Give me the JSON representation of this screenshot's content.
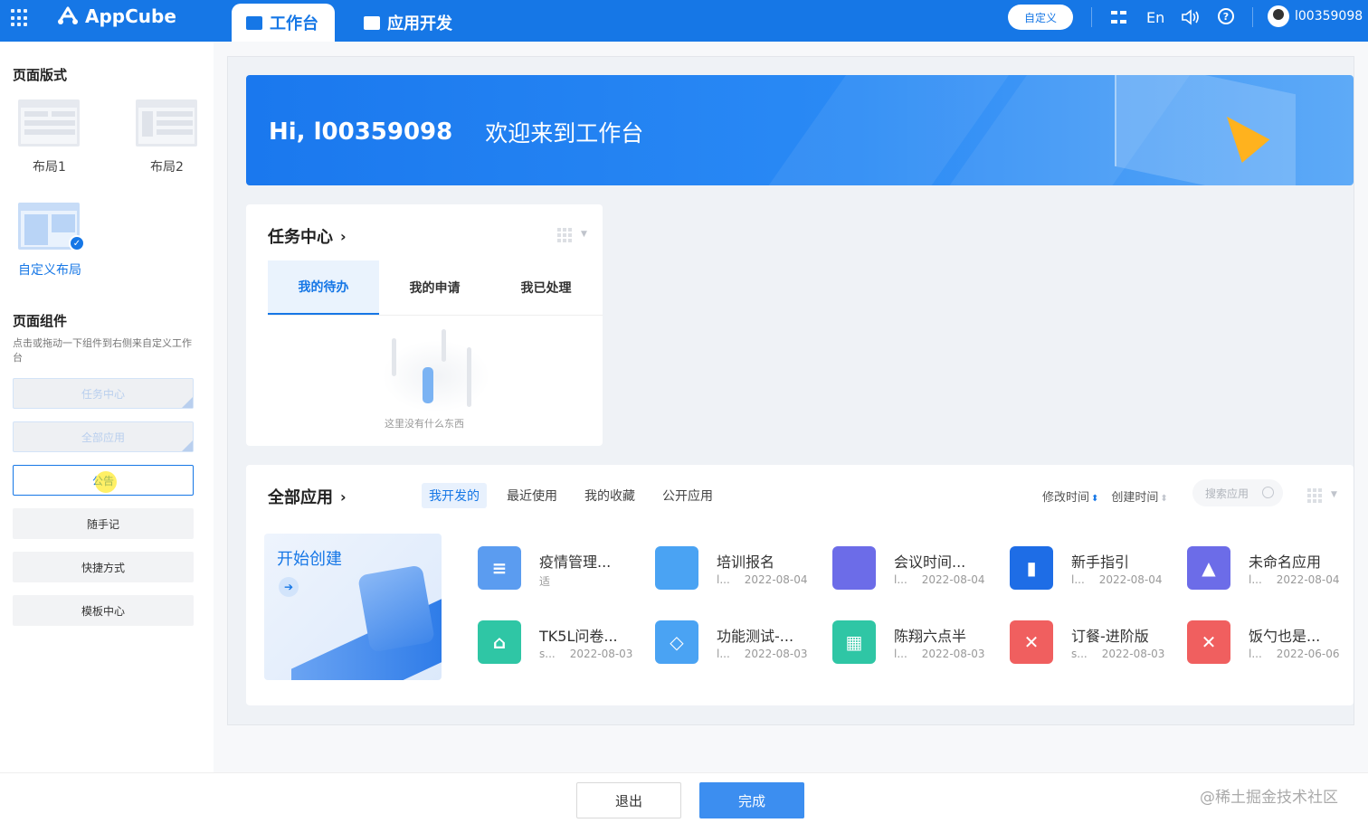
{
  "header": {
    "logo": "AppCube",
    "tabs": [
      {
        "label": "工作台"
      },
      {
        "label": "应用开发"
      }
    ],
    "custom_button": "自定义",
    "lang": "En",
    "help": "?",
    "username": "l00359098"
  },
  "sidebar": {
    "layout_title": "页面版式",
    "layouts": [
      "布局1",
      "布局2"
    ],
    "custom_layout": "自定义布局",
    "components_title": "页面组件",
    "components_hint": "点击或拖动一下组件到右侧来自定义工作台",
    "components": [
      "任务中心",
      "全部应用",
      "公告",
      "随手记",
      "快捷方式",
      "模板中心"
    ]
  },
  "banner": {
    "greeting": "Hi, l00359098",
    "welcome": "欢迎来到工作台"
  },
  "task_center": {
    "title": "任务中心",
    "tabs": [
      "我的待办",
      "我的申请",
      "我已处理"
    ],
    "empty_text": "这里没有什么东西"
  },
  "all_apps": {
    "title": "全部应用",
    "tabs": [
      "我开发的",
      "最近使用",
      "我的收藏",
      "公开应用"
    ],
    "sort_modified": "修改时间",
    "sort_created": "创建时间",
    "search_placeholder": "搜索应用",
    "start_create": "开始创建",
    "apps": [
      {
        "name": "疫情管理...",
        "meta": "适",
        "date": "",
        "color": "#5b9cf0",
        "icon": "document-icon"
      },
      {
        "name": "培训报名",
        "meta": "l...",
        "date": "2022-08-04",
        "color": "#4aa3f3",
        "icon": "code-icon"
      },
      {
        "name": "会议时间...",
        "meta": "l...",
        "date": "2022-08-04",
        "color": "#6c6ce8",
        "icon": "code-icon"
      },
      {
        "name": "新手指引",
        "meta": "l...",
        "date": "2022-08-04",
        "color": "#1e6de6",
        "icon": "bookmark-icon"
      },
      {
        "name": "未命名应用",
        "meta": "l...",
        "date": "2022-08-04",
        "color": "#6c6ce8",
        "icon": "calendar-icon"
      },
      {
        "name": "TK5L问卷...",
        "meta": "s...",
        "date": "2022-08-03",
        "color": "#2fc6a5",
        "icon": "home-icon"
      },
      {
        "name": "功能测试-...",
        "meta": "l...",
        "date": "2022-08-03",
        "color": "#4aa3f3",
        "icon": "shield-icon"
      },
      {
        "name": "陈翔六点半",
        "meta": "l...",
        "date": "2022-08-03",
        "color": "#2fc6a5",
        "icon": "chip-icon"
      },
      {
        "name": "订餐-进阶版",
        "meta": "s...",
        "date": "2022-08-03",
        "color": "#f05f5f",
        "icon": "utensils-icon"
      },
      {
        "name": "饭勺也是...",
        "meta": "l...",
        "date": "2022-06-06",
        "color": "#f05f5f",
        "icon": "utensils-icon"
      }
    ]
  },
  "footer": {
    "exit": "退出",
    "done": "完成",
    "watermark": "@稀土掘金技术社区"
  }
}
